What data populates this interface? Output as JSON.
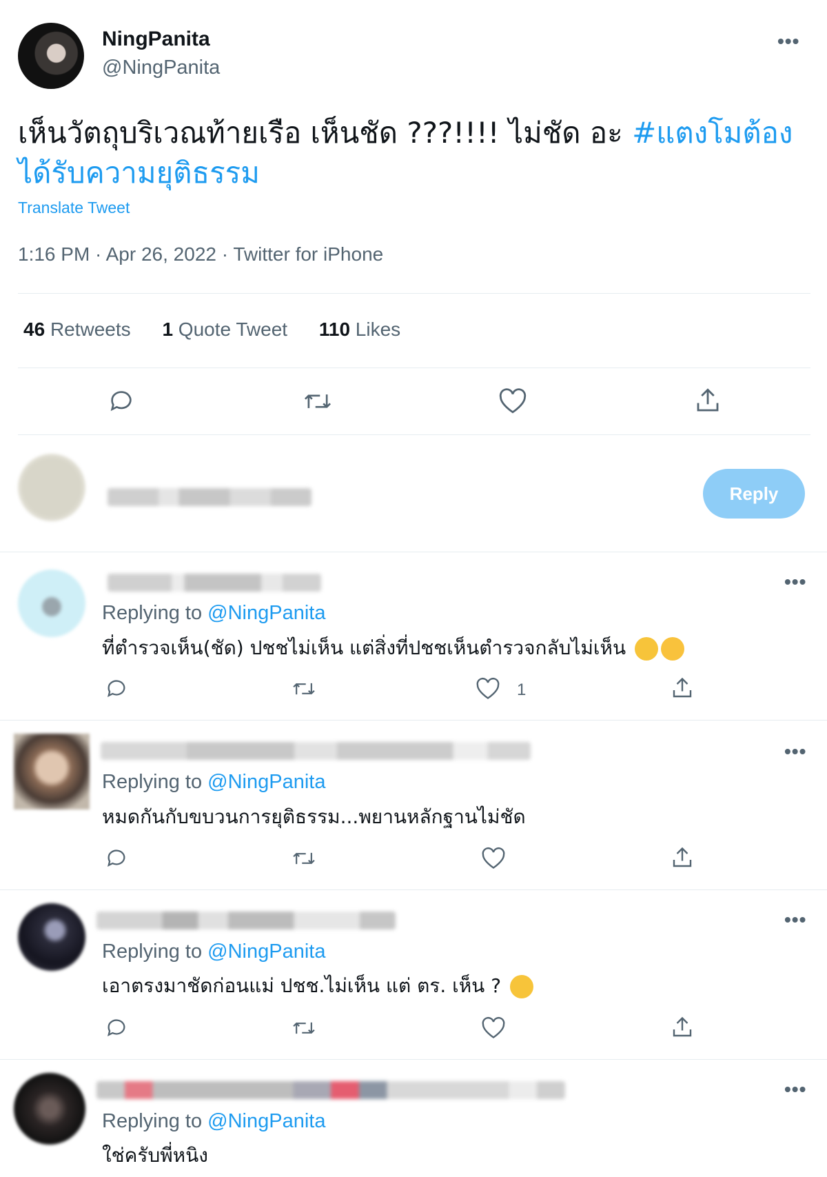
{
  "main_tweet": {
    "display_name": "NingPanita",
    "handle": "@NingPanita",
    "more_label": "•••",
    "text_plain": "เห็นวัตถุบริเวณท้ายเรือ เห็นชัด ???!!!! ไม่ชัด อะ ",
    "hashtag": "#แตงโมต้องได้รับความยุติธรรม",
    "translate_label": "Translate Tweet",
    "meta": "1:16 PM · Apr 26, 2022 · Twitter for iPhone",
    "stats": {
      "retweets_count": "46",
      "retweets_label": "Retweets",
      "quotes_count": "1",
      "quotes_label": "Quote Tweet",
      "likes_count": "110",
      "likes_label": "Likes"
    },
    "actions": [
      "reply-icon",
      "retweet-icon",
      "like-icon",
      "share-icon"
    ]
  },
  "composer": {
    "reply_button_label": "Reply"
  },
  "replies": [
    {
      "replying_prefix": "Replying to ",
      "replying_handle": "@NingPanita",
      "text": "ที่ตำรวจเห็น(ชัด) ปชชไม่เห็น  แต่สิ่งที่ปชชเห็นตำรวจกลับไม่เห็น",
      "emojis": [
        "dizzy-face-emoji",
        "crying-face-emoji"
      ],
      "like_count": "1",
      "more_label": "•••"
    },
    {
      "replying_prefix": "Replying to ",
      "replying_handle": "@NingPanita",
      "text": "หมดกันกับขบวนการยุติธรรม...พยานหลักฐานไม่ชัด",
      "emojis": [],
      "like_count": "",
      "more_label": "•••"
    },
    {
      "replying_prefix": "Replying to ",
      "replying_handle": "@NingPanita",
      "text": "เอาตรงมาชัดก่อนแม่ ปชช.ไม่เห็น แต่ ตร. เห็น ?",
      "emojis": [
        "eye-roll-emoji"
      ],
      "like_count": "",
      "more_label": "•••"
    },
    {
      "replying_prefix": "Replying to ",
      "replying_handle": "@NingPanita",
      "text": "ใช่ครับพี่หนิง",
      "emojis": [],
      "like_count": "",
      "more_label": "•••"
    }
  ],
  "colors": {
    "accent": "#1d9bf0",
    "secondary_text": "#536471",
    "reply_button_disabled": "#8ecdf7"
  }
}
